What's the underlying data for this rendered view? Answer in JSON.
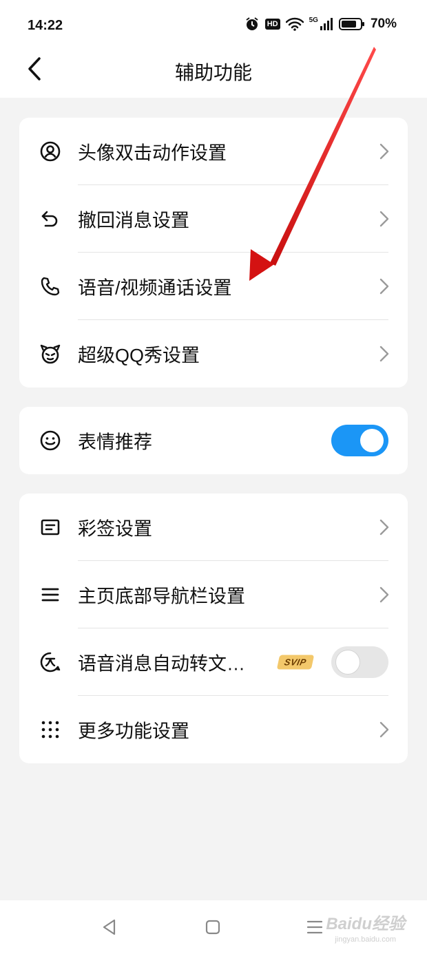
{
  "status_bar": {
    "time": "14:22",
    "hd_label": "HD",
    "network_label": "5G",
    "battery": "70%"
  },
  "header": {
    "title": "辅助功能",
    "back_icon": "chevron-left-icon"
  },
  "group1": {
    "items": [
      {
        "label": "头像双击动作设置",
        "icon": "user-circle-icon"
      },
      {
        "label": "撤回消息设置",
        "icon": "undo-icon"
      },
      {
        "label": "语音/视频通话设置",
        "icon": "phone-icon"
      },
      {
        "label": "超级QQ秀设置",
        "icon": "qq-show-icon"
      }
    ]
  },
  "group2": {
    "items": [
      {
        "label": "表情推荐",
        "icon": "smiley-icon",
        "toggle": true
      }
    ]
  },
  "group3": {
    "items": [
      {
        "label": "彩签设置",
        "icon": "card-icon"
      },
      {
        "label": "主页底部导航栏设置",
        "icon": "menu-icon"
      },
      {
        "label": "语音消息自动转文…",
        "icon": "voice-to-text-icon",
        "badge": "SVIP",
        "toggle": false
      },
      {
        "label": "更多功能设置",
        "icon": "grid-icon"
      }
    ]
  },
  "colors": {
    "accent": "#1b96f6",
    "background": "#f3f3f3",
    "arrow": "#e01818"
  },
  "watermark": {
    "main": "Baidu经验",
    "sub": "jingyan.baidu.com"
  }
}
